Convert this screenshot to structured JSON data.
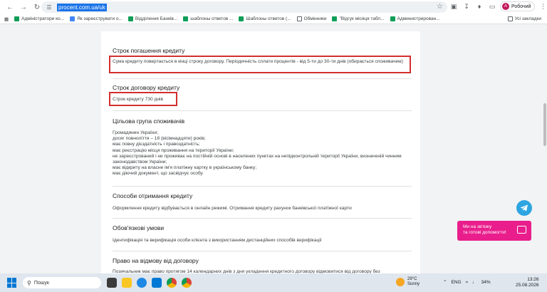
{
  "browser": {
    "url": "procent.com.ua/uk",
    "profile_label": "Робочий",
    "profile_initial": "A"
  },
  "bookmarks": [
    "Адміністратори ко...",
    "Як зареєструвати о...",
    "Відділення Банків...",
    "шаблоны ответов ...",
    "Шаблоны ответов (...",
    "Обмінники",
    "\"Відгук місяця табл...",
    "Администрирован..."
  ],
  "bookmarks_all": "Усі закладки",
  "sections": [
    {
      "title": "Строк погашення кредиту",
      "text": "Сума кредиту повертається в кінці строку договору. Періодичність сплати процентів - від 5-ти до 30-ти днів (обирається споживачем)"
    },
    {
      "title": "Строк договору кредиту",
      "text": "Строк кредиту 730 днів"
    },
    {
      "title": "Цільова група споживачів",
      "lines": [
        "Громадянин України;",
        "досяг повноліття – 18 (вісімнадцяти) років;",
        "має повну дієздатність і правоздатність;",
        "має реєстрацію місця проживання на території України;",
        "не зареєстрований і не проживає на постійній основі в населених пунктах на непідконтрольній території України, визначеній чинним законодавством України;",
        "має відкриту на власне ім'я платіжну картку в українському банку;",
        "має діючий документ, що засвідчує особу"
      ]
    },
    {
      "title": "Способи отримання кредиту",
      "text": "Оформлення кредиту відбувається в онлайн режимі. Отримання кредиту рахунок банківської платіжної карти"
    },
    {
      "title": "Обов'язкові умови",
      "text": "Ідентифікація та верифікація особи клієнта з використанням дистанційних способів верифікації"
    },
    {
      "title": "Право на відмову від договору",
      "text": "Позичальник має право протягом 14 календарних днів з дня укладення кредитного договору відмовитися від договору без"
    }
  ],
  "chat_widget": {
    "line1": "Ми на зв'язку",
    "line2": "та готові допомогти!"
  },
  "taskbar": {
    "search_label": "Пошук",
    "weather_temp": "29°C",
    "weather_desc": "Sunny",
    "lang": "ENG",
    "battery": "34%",
    "time": "13:26",
    "date": "25.08.2026"
  }
}
